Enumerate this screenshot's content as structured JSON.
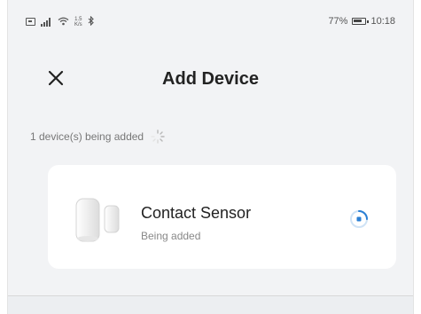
{
  "status_bar": {
    "speed_top": "1.5",
    "speed_bottom": "K/s",
    "battery_level": "77%",
    "time": "10:18",
    "icons": [
      "sim-icon",
      "signal-icon",
      "wifi-icon",
      "bluetooth-icon",
      "battery-icon"
    ]
  },
  "header": {
    "title": "Add Device",
    "close_icon": "close-icon"
  },
  "adding": {
    "status_text": "1 device(s) being added",
    "icon": "loading-spinner-icon"
  },
  "device": {
    "name": "Contact Sensor",
    "status": "Being added",
    "thumb": "contact-sensor-image",
    "progress_icon": "progress-indicator-icon"
  },
  "colors": {
    "background": "#f2f3f5",
    "card": "#ffffff",
    "progress_accent": "#2a7fd4"
  }
}
